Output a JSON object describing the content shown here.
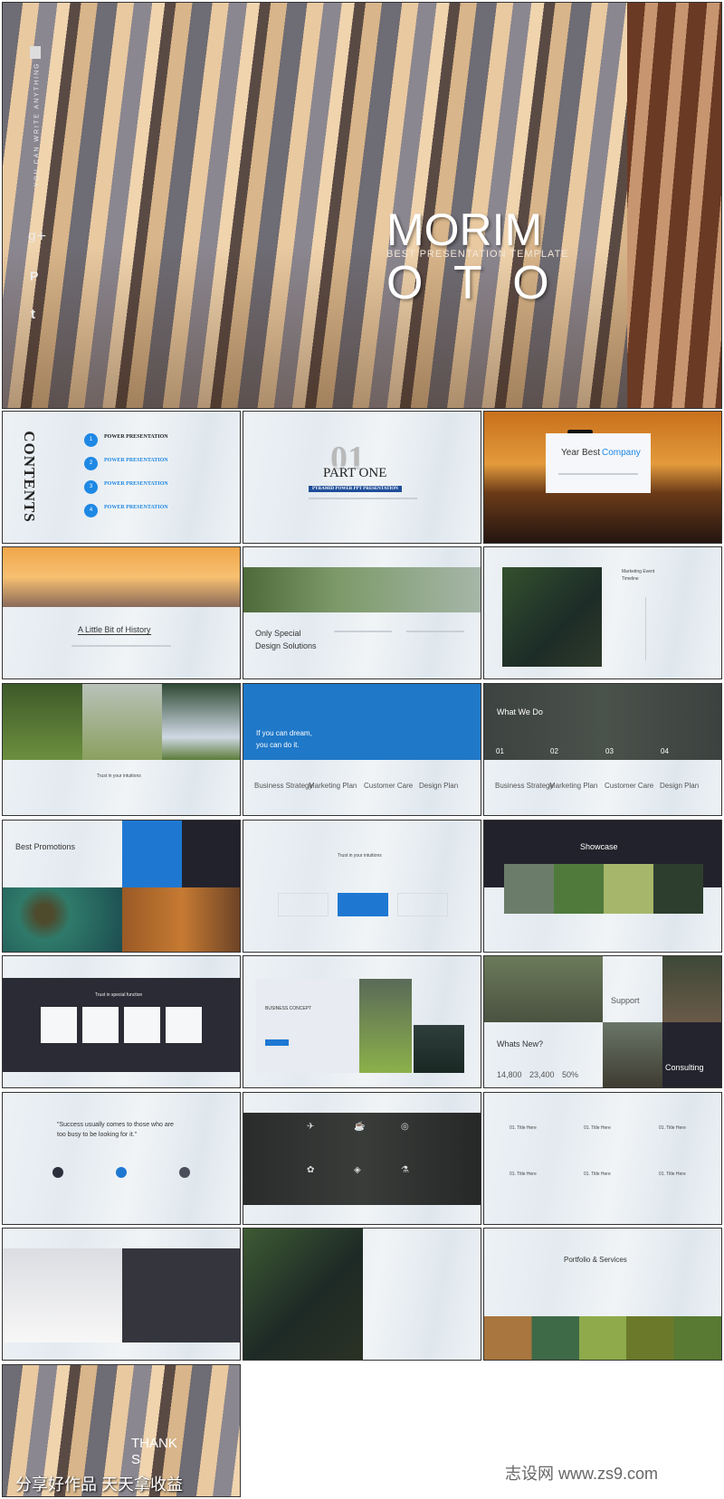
{
  "cover": {
    "title_line1": "MORIM",
    "subtitle": "BEST PRESENTATION TEMPLATE",
    "title_line2": "O T O",
    "vertical_text": "YOU CAN WRITE ANYTHING",
    "social_icons": [
      "google-plus-icon",
      "pinterest-icon",
      "tumblr-icon"
    ]
  },
  "contents": {
    "heading": "CONTENTS",
    "items": [
      {
        "num": "1",
        "label": "POWER PRESENTATION"
      },
      {
        "num": "2",
        "label": "POWER PRESENTATION"
      },
      {
        "num": "3",
        "label": "POWER PRESENTATION"
      },
      {
        "num": "4",
        "label": "POWER PRESENTATION"
      }
    ],
    "accent": "#1e88e5"
  },
  "part_one": {
    "number": "01",
    "title": "PART ONE",
    "banner": "PYRAMID POWER PPT PRESENTATION",
    "banner_color": "#1f4e9a"
  },
  "year_best": {
    "title_a": "Year Best",
    "title_b": "Company",
    "accent": "#1e88e5"
  },
  "history": {
    "title": "A Little Bit of History"
  },
  "design": {
    "title_line1": "Only Special",
    "title_line2": "Design Solutions"
  },
  "timeline": {
    "title_line1": "Marketing Event",
    "title_line2": "Timeline"
  },
  "trust1": {
    "title": "Trust in your intuitions"
  },
  "dream": {
    "line1": "If you can dream,",
    "line2": "you can do it.",
    "items": [
      "Business Strategy",
      "Marketing Plan",
      "Customer Care",
      "Design Plan"
    ],
    "bg": "#1f78c8"
  },
  "what_we_do": {
    "title": "What We Do",
    "numbers": [
      "01",
      "02",
      "03",
      "04"
    ],
    "items": [
      "Business Strategy",
      "Marketing Plan",
      "Customer Care",
      "Design Plan"
    ]
  },
  "promotions": {
    "title": "Best Promotions"
  },
  "trust2": {
    "title": "Trust in your intuitions"
  },
  "showcase": {
    "title": "Showcase"
  },
  "special": {
    "title": "Trust in special function"
  },
  "concept": {
    "title": "BUSINESS CONCEPT"
  },
  "whats_new": {
    "title": "Whats New?",
    "stats": [
      "14,800",
      "23,400",
      "50%"
    ],
    "support": "Support",
    "consulting": "Consulting"
  },
  "quote": {
    "text_line1": "\"Success usually comes to those who are",
    "text_line2": "too busy to be looking for it.\""
  },
  "titles": {
    "items": [
      "01. Title Here",
      "01. Title Here",
      "01. Title Here",
      "01. Title Here",
      "01. Title Here",
      "01. Title Here"
    ]
  },
  "portfolio": {
    "title": "Portfolio & Services"
  },
  "thanks": {
    "title": "THANK",
    "title2": "S"
  },
  "watermark": {
    "left": "分享好作品 天天拿收益",
    "right": "志设网 www.zs9.com"
  }
}
